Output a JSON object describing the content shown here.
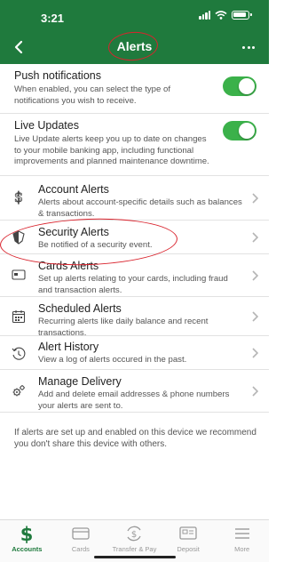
{
  "status_bar": {
    "time": "3:21"
  },
  "header": {
    "title": "Alerts"
  },
  "toggles": [
    {
      "title": "Push notifications",
      "desc": "When enabled, you can select the type of notifications you wish to receive.",
      "enabled": true
    },
    {
      "title": "Live Updates",
      "desc": "Live Update alerts keep you up to date on changes to your mobile banking app, including functional improvements and planned maintenance downtime.",
      "enabled": true
    }
  ],
  "menu": [
    {
      "title": "Account Alerts",
      "desc": "Alerts about account-specific details such as balances & transactions.",
      "icon": "dollar-icon"
    },
    {
      "title": "Security Alerts",
      "desc": "Be notified of a security event.",
      "icon": "shield-icon"
    },
    {
      "title": "Cards Alerts",
      "desc": "Set up alerts relating to your cards, including fraud and transaction alerts.",
      "icon": "card-icon"
    },
    {
      "title": "Scheduled Alerts",
      "desc": "Recurring alerts like daily balance and recent transactions.",
      "icon": "calendar-icon"
    },
    {
      "title": "Alert History",
      "desc": "View a log of alerts occured in the past.",
      "icon": "history-icon"
    },
    {
      "title": "Manage Delivery",
      "desc": "Add and delete email addresses & phone numbers your alerts are sent to.",
      "icon": "gears-icon"
    }
  ],
  "footer_note": "If alerts are set up and enabled on this device we recommend you don't share this device with others.",
  "tabs": [
    {
      "label": "Accounts",
      "icon": "dollar-icon",
      "active": true
    },
    {
      "label": "Cards",
      "icon": "card-icon",
      "active": false
    },
    {
      "label": "Transfer & Pay",
      "icon": "transfer-icon",
      "active": false
    },
    {
      "label": "Deposit",
      "icon": "deposit-icon",
      "active": false
    },
    {
      "label": "More",
      "icon": "menu-icon",
      "active": false
    }
  ],
  "colors": {
    "brand_green": "#1f7a3d",
    "toggle_green": "#3bb14a",
    "annotation_red": "#d9232d"
  }
}
